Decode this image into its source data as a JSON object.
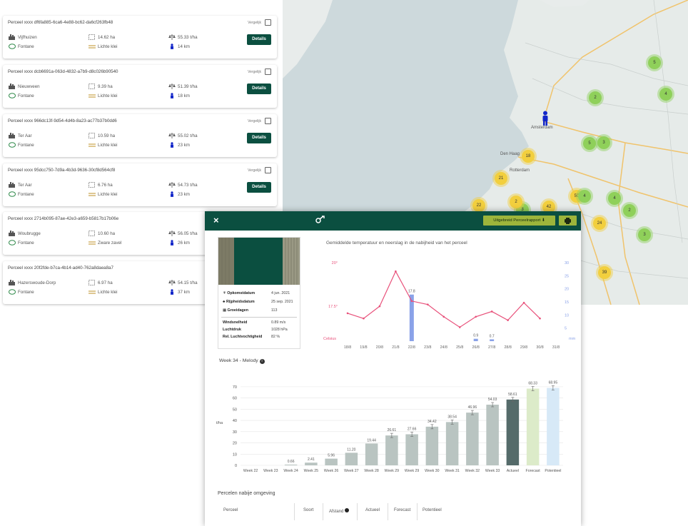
{
  "parcels": [
    {
      "title": "Perceel xxxx df6fa885-6ca6-4e88-bc62-da6cf263fb48",
      "vergelijk": "Vergelijk",
      "location": "Vijfhuizen",
      "area": "14.62 ha",
      "yield": "55.33 t/ha",
      "variety": "Fontane",
      "soil": "Lichte klei",
      "distance": "14 km",
      "show_details": true
    },
    {
      "title": "Perceel xxxx dcb6691a-063d-4832-a7b9-d8c026b90540",
      "vergelijk": "Vergelijk",
      "location": "Nieuwveen",
      "area": "9.39 ha",
      "yield": "51.39 t/ha",
      "variety": "Fontane",
      "soil": "Lichte klei",
      "distance": "18 km",
      "show_details": true
    },
    {
      "title": "Perceel xxxx 966dc13f-9d54-4d4b-8a23-ac77b37b0dd6",
      "vergelijk": "Vergelijk",
      "location": "Ter Aar",
      "area": "10.59 ha",
      "yield": "55.02 t/ha",
      "variety": "Fontane",
      "soil": "Lichte klei",
      "distance": "23 km",
      "show_details": true
    },
    {
      "title": "Perceel xxxx 95dcc750-7d9a-4b3d-9636-30cf8d564cf8",
      "vergelijk": "Vergelijk",
      "location": "Ter Aar",
      "area": "6.76 ha",
      "yield": "54.73 t/ha",
      "variety": "Fontane",
      "soil": "Lichte klei",
      "distance": "23 km",
      "show_details": true
    },
    {
      "title": "Perceel xxxx 2714b095-87ae-42e3-a659-b5817b17b06e",
      "vergelijk": "",
      "location": "Woubrugge",
      "area": "10.60 ha",
      "yield": "56.05 t/ha",
      "variety": "Fontane",
      "soil": "Zware zavel",
      "distance": "26 km",
      "show_details": false
    },
    {
      "title": "Perceel xxxx 20f2fde-b7ca-4b14-ad40-762a8daea8a7",
      "vergelijk": "",
      "location": "Hazerswoude-Dorp",
      "area": "6.97 ha",
      "yield": "54.15 t/ha",
      "variety": "Fontane",
      "soil": "Lichte klei",
      "distance": "37 km",
      "show_details": false
    }
  ],
  "details_label": "Details",
  "map": {
    "clusters": [
      {
        "label": "5",
        "color": "green"
      },
      {
        "label": "4",
        "color": "green"
      },
      {
        "label": "2",
        "color": "green"
      },
      {
        "label": "5",
        "color": "green"
      },
      {
        "label": "3",
        "color": "green"
      },
      {
        "label": "18",
        "color": "yellow"
      },
      {
        "label": "21",
        "color": "yellow"
      },
      {
        "label": "22",
        "color": "yellow"
      },
      {
        "label": "42",
        "color": "yellow"
      },
      {
        "label": "50",
        "color": "yellow"
      },
      {
        "label": "4",
        "color": "green"
      },
      {
        "label": "4",
        "color": "green"
      },
      {
        "label": "2",
        "color": "green"
      },
      {
        "label": "24",
        "color": "yellow"
      },
      {
        "label": "3",
        "color": "green"
      },
      {
        "label": "39",
        "color": "yellow"
      },
      {
        "label": "3",
        "color": "green"
      },
      {
        "label": "2",
        "color": "yellow"
      }
    ],
    "places": [
      "Amsterdam",
      "Den Haag",
      "Rotterdam"
    ]
  },
  "panel": {
    "close": "×",
    "report_button": "Uitgebreid Perceelrapport",
    "info": {
      "opkomst_label": "Opkomstdatum",
      "opkomst": "4 jun. 2021",
      "rijpheid_label": "Rijpheidsdatum",
      "rijpheid": "25 sep. 2021",
      "groeidagen_label": "Groeidagen",
      "groeidagen": "113",
      "wind_label": "Windsnelheid",
      "wind": "0.89 m/s",
      "druk_label": "Luchtdruk",
      "druk": "1028 hPa",
      "vocht_label": "Rel. Luchtvochtigheid",
      "vocht": "82 %"
    },
    "weather_title": "Gemiddelde temperatuur en neerslag in de nabijheid van het perceel",
    "week_title": "Week 34 - Melody",
    "nearby_title": "Percelen nabije omgeving",
    "table_headers": [
      "Perceel",
      "Soort",
      "Afstand",
      "Actueel",
      "Forecast",
      "Potentieel"
    ]
  },
  "chart_data": [
    {
      "type": "line",
      "title": "Gemiddelde temperatuur en neerslag in de nabijheid van het perceel",
      "categories": [
        "18/8",
        "19/8",
        "20/8",
        "21/8",
        "22/8",
        "23/8",
        "24/8",
        "25/8",
        "26/8",
        "27/8",
        "28/8",
        "29/8",
        "30/8",
        "31/8"
      ],
      "series": [
        {
          "kind": "line",
          "values": [
            17.1,
            16.8,
            17.5,
            19.5,
            17.8,
            17.6,
            16.9,
            16.3,
            16.9,
            17.2,
            16.7,
            17.7,
            16.8
          ]
        },
        {
          "kind": "bar",
          "values": [
            0,
            0,
            0,
            0,
            17.8,
            0,
            0,
            0,
            0.9,
            0.7,
            0,
            0,
            0,
            0
          ]
        }
      ],
      "left_ticks": [
        "20°",
        "17.5°"
      ],
      "right_ticks": [
        "30",
        "25",
        "20",
        "15",
        "10",
        "5"
      ],
      "left_unit": "Celsius",
      "right_unit": "mm",
      "left_ylim": [
        15.5,
        20
      ],
      "right_ylim": [
        0,
        30
      ],
      "bar_labels": {
        "22/8": "17.8",
        "26/8": "0.9",
        "27/8": "0.7"
      },
      "colors": {
        "line": "#e8507a",
        "bar": "#8aa2e8"
      }
    },
    {
      "type": "bar",
      "title": "Week 34 - Melody",
      "categories": [
        "Week 22",
        "Week 23",
        "Week 24",
        "Week 25",
        "Week 26",
        "Week 27",
        "Week 28",
        "Week 29",
        "Week 29",
        "Week 30",
        "Week 31",
        "Week 32",
        "Week 33",
        "Actueel",
        "Forecast",
        "Potentieel"
      ],
      "values": [
        0,
        0,
        0.66,
        2.41,
        5.96,
        11.2,
        19.44,
        26.61,
        27.66,
        34.42,
        38.54,
        46.96,
        54.03,
        58.61,
        68.33,
        68.95
      ],
      "labels": [
        "",
        "",
        "0.66",
        "2.41",
        "5.96",
        "11.20",
        "19.44",
        "26.61",
        "27.66",
        "34.42",
        "38.54",
        "46.96",
        "54.03",
        "58.61",
        "68.33",
        "68.95"
      ],
      "ylabel": "t/ha",
      "ylim": [
        0,
        75
      ],
      "yticks": [
        0,
        10,
        20,
        30,
        40,
        50,
        60,
        70
      ],
      "colors": {
        "default": "#b9c4c1",
        "actueel": "#556b6a",
        "forecast": "#dcebc9",
        "potentieel": "#d7e9f7"
      }
    }
  ]
}
